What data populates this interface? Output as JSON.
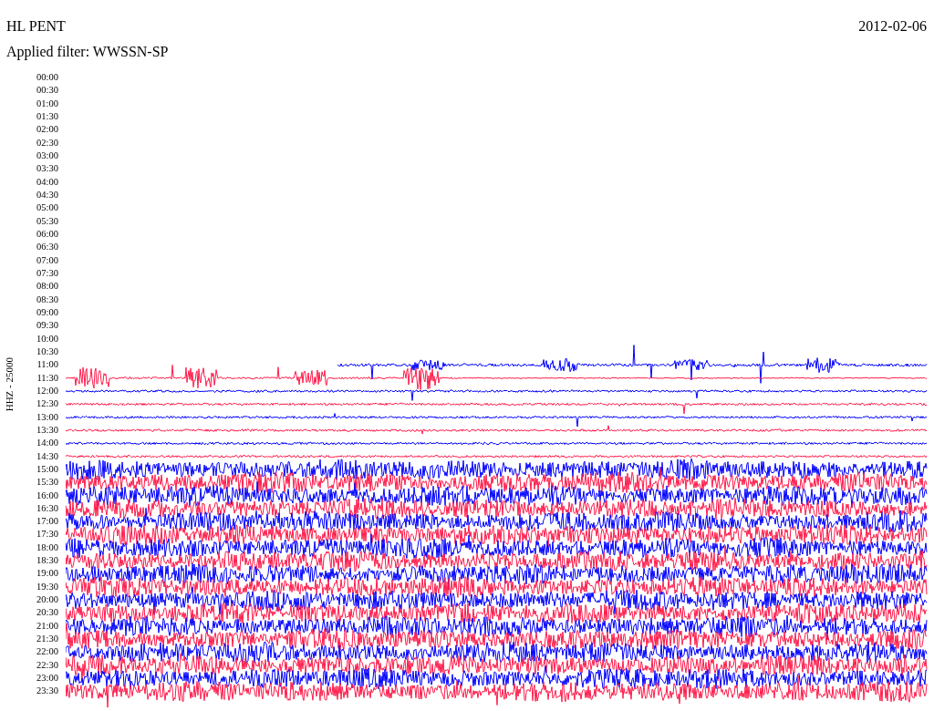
{
  "header": {
    "station": "HL PENT",
    "date": "2012-02-06",
    "filter": "Applied filter: WWSSN-SP"
  },
  "axis_label": "HHZ - 25000",
  "rows": [
    {
      "time": "00:00",
      "kind": "none"
    },
    {
      "time": "00:30",
      "kind": "none"
    },
    {
      "time": "01:00",
      "kind": "none"
    },
    {
      "time": "01:30",
      "kind": "none"
    },
    {
      "time": "02:00",
      "kind": "none"
    },
    {
      "time": "02:30",
      "kind": "none"
    },
    {
      "time": "03:00",
      "kind": "none"
    },
    {
      "time": "03:30",
      "kind": "none"
    },
    {
      "time": "04:00",
      "kind": "none"
    },
    {
      "time": "04:30",
      "kind": "none"
    },
    {
      "time": "05:00",
      "kind": "none"
    },
    {
      "time": "05:30",
      "kind": "none"
    },
    {
      "time": "06:00",
      "kind": "none"
    },
    {
      "time": "06:30",
      "kind": "none"
    },
    {
      "time": "07:00",
      "kind": "none"
    },
    {
      "time": "07:30",
      "kind": "none"
    },
    {
      "time": "08:00",
      "kind": "none"
    },
    {
      "time": "08:30",
      "kind": "none"
    },
    {
      "time": "09:00",
      "kind": "none"
    },
    {
      "time": "09:30",
      "kind": "none"
    },
    {
      "time": "10:00",
      "kind": "none"
    },
    {
      "time": "10:30",
      "kind": "none"
    },
    {
      "time": "11:00",
      "kind": "late",
      "color": "#0000ff"
    },
    {
      "time": "11:30",
      "kind": "burst",
      "color": "#ff1a4a"
    },
    {
      "time": "12:00",
      "kind": "quiet",
      "color": "#0000ff"
    },
    {
      "time": "12:30",
      "kind": "quiet",
      "color": "#ff1a4a"
    },
    {
      "time": "13:00",
      "kind": "quiet",
      "color": "#0000ff"
    },
    {
      "time": "13:30",
      "kind": "quiet",
      "color": "#ff1a4a"
    },
    {
      "time": "14:00",
      "kind": "quiet",
      "color": "#0000ff"
    },
    {
      "time": "14:30",
      "kind": "quiet",
      "color": "#ff1a4a"
    },
    {
      "time": "15:00",
      "kind": "noisy",
      "color": "#0000ff"
    },
    {
      "time": "15:30",
      "kind": "noisy",
      "color": "#ff1a4a"
    },
    {
      "time": "16:00",
      "kind": "noisy",
      "color": "#0000ff"
    },
    {
      "time": "16:30",
      "kind": "noisy",
      "color": "#ff1a4a"
    },
    {
      "time": "17:00",
      "kind": "noisy",
      "color": "#0000ff"
    },
    {
      "time": "17:30",
      "kind": "noisy",
      "color": "#ff1a4a"
    },
    {
      "time": "18:00",
      "kind": "noisy",
      "color": "#0000ff"
    },
    {
      "time": "18:30",
      "kind": "noisy",
      "color": "#ff1a4a"
    },
    {
      "time": "19:00",
      "kind": "noisy",
      "color": "#0000ff"
    },
    {
      "time": "19:30",
      "kind": "noisy",
      "color": "#ff1a4a"
    },
    {
      "time": "20:00",
      "kind": "noisy",
      "color": "#0000ff"
    },
    {
      "time": "20:30",
      "kind": "noisy",
      "color": "#ff1a4a"
    },
    {
      "time": "21:00",
      "kind": "noisy",
      "color": "#0000ff"
    },
    {
      "time": "21:30",
      "kind": "noisy",
      "color": "#ff1a4a"
    },
    {
      "time": "22:00",
      "kind": "noisy",
      "color": "#0000ff"
    },
    {
      "time": "22:30",
      "kind": "noisy",
      "color": "#ff1a4a"
    },
    {
      "time": "23:00",
      "kind": "noisy",
      "color": "#0000ff"
    },
    {
      "time": "23:30",
      "kind": "noisy",
      "color": "#ff1a4a"
    }
  ]
}
